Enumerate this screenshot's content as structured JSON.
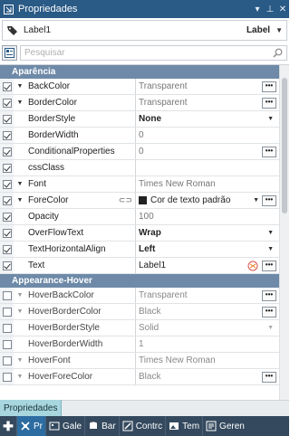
{
  "panel": {
    "title": "Propriedades",
    "buttons": {
      "dropdown": "▾",
      "pin": "⊥",
      "close": "✕"
    }
  },
  "object_selector": {
    "name": "Label1",
    "type": "Label"
  },
  "search": {
    "placeholder": "Pesquisar"
  },
  "categories": [
    {
      "title": "Aparência",
      "rows": [
        {
          "name": "BackColor",
          "checked": true,
          "expander": true,
          "value": "Transparent",
          "value_style": "gray",
          "control": "ellipsis"
        },
        {
          "name": "BorderColor",
          "checked": true,
          "expander": true,
          "value": "Transparent",
          "value_style": "gray",
          "control": "ellipsis"
        },
        {
          "name": "BorderStyle",
          "checked": true,
          "expander": false,
          "value": "None",
          "value_style": "bold",
          "control": "dropdown"
        },
        {
          "name": "BorderWidth",
          "checked": true,
          "expander": false,
          "value": "0",
          "value_style": "gray",
          "control": "none"
        },
        {
          "name": "ConditionalProperties",
          "checked": true,
          "expander": false,
          "value": "0",
          "value_style": "gray",
          "control": "ellipsis"
        },
        {
          "name": "cssClass",
          "checked": true,
          "expander": false,
          "value": "",
          "value_style": "",
          "control": "none"
        },
        {
          "name": "Font",
          "checked": true,
          "expander": true,
          "value": "Times New Roman",
          "value_style": "gray",
          "control": "none"
        },
        {
          "name": "ForeColor",
          "checked": true,
          "expander": true,
          "value": "Cor de texto padrão",
          "value_style": "",
          "control": "ellipsis_dropdown",
          "swatch": "#222222",
          "link": true
        },
        {
          "name": "Opacity",
          "checked": true,
          "expander": false,
          "value": "100",
          "value_style": "gray",
          "control": "none"
        },
        {
          "name": "OverFlowText",
          "checked": true,
          "expander": false,
          "value": "Wrap",
          "value_style": "bold",
          "control": "dropdown"
        },
        {
          "name": "TextHorizontalAlign",
          "checked": true,
          "expander": false,
          "value": "Left",
          "value_style": "bold",
          "control": "dropdown"
        },
        {
          "name": "Text",
          "checked": true,
          "expander": false,
          "value": "Label1",
          "value_style": "",
          "control": "ellipsis",
          "localize": true
        }
      ]
    },
    {
      "title": "Appearance-Hover",
      "rows": [
        {
          "name": "HoverBackColor",
          "checked": false,
          "expander": true,
          "value": "Transparent",
          "value_style": "gray",
          "control": "ellipsis"
        },
        {
          "name": "HoverBorderColor",
          "checked": false,
          "expander": true,
          "value": "Black",
          "value_style": "gray",
          "control": "ellipsis"
        },
        {
          "name": "HoverBorderStyle",
          "checked": false,
          "expander": false,
          "value": "Solid",
          "value_style": "gray",
          "control": "dropdown_light"
        },
        {
          "name": "HoverBorderWidth",
          "checked": false,
          "expander": false,
          "value": "1",
          "value_style": "gray",
          "control": "none"
        },
        {
          "name": "HoverFont",
          "checked": false,
          "expander": true,
          "value": "Times New Roman",
          "value_style": "gray",
          "control": "none"
        },
        {
          "name": "HoverForeColor",
          "checked": false,
          "expander": true,
          "value": "Black",
          "value_style": "gray",
          "control": "ellipsis"
        }
      ]
    }
  ],
  "footer": {
    "active_tab": "Propriedades",
    "bottom_tabs": [
      {
        "label": "Pr",
        "icon": "properties-icon",
        "active": true
      },
      {
        "label": "Gale",
        "icon": "gallery-icon",
        "active": false
      },
      {
        "label": "Bar",
        "icon": "database-icon",
        "active": false
      },
      {
        "label": "Contrc",
        "icon": "edit-icon",
        "active": false
      },
      {
        "label": "Tem",
        "icon": "image-icon",
        "active": false
      },
      {
        "label": "Geren",
        "icon": "manager-icon",
        "active": false
      }
    ]
  },
  "colors": {
    "title_bar": "#2a5a86",
    "category_header": "#6e8aa8",
    "bottom_bar": "#34495e",
    "active_tab": "#a8d6df"
  }
}
